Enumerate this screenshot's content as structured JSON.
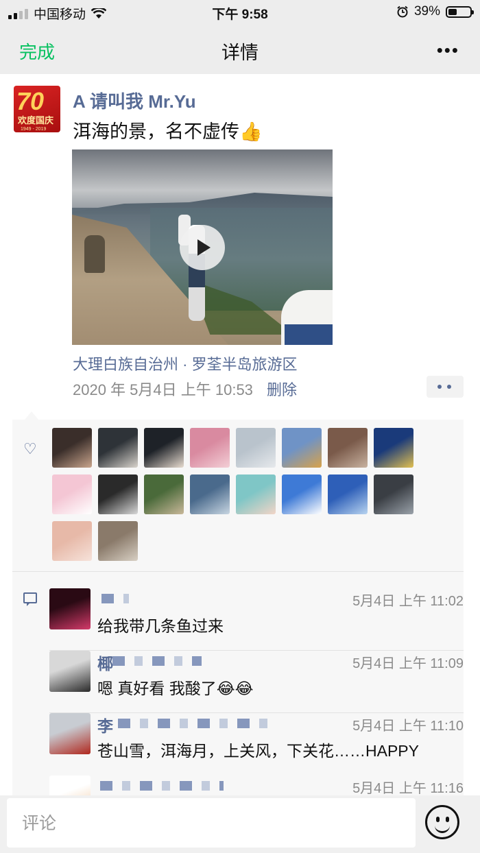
{
  "status_bar": {
    "carrier": "中国移动",
    "time": "下午 9:58",
    "battery": "39%",
    "battery_level": 0.39
  },
  "nav": {
    "done_label": "完成",
    "title": "详情",
    "more": "•••"
  },
  "post": {
    "author": "A 请叫我 Mr.Yu",
    "avatar_badge_number": "70",
    "avatar_badge_text": "欢度国庆",
    "avatar_badge_years": "1949 - 2019",
    "text": "洱海的景，名不虚传👍",
    "location": "大理白族自治州 · 罗荃半岛旅游区",
    "timestamp": "2020 年 5月4日 上午 10:53",
    "delete_label": "删除"
  },
  "likes": {
    "icon": "heart-icon",
    "avatar_colors": [
      [
        "#3a2e2a",
        "#c9a58d"
      ],
      [
        "#2e3338",
        "#d9d4cd"
      ],
      [
        "#1e2228",
        "#e8dcd0"
      ],
      [
        "#d98aa0",
        "#f3cfd6"
      ],
      [
        "#b9c3cc",
        "#e6e9ec"
      ],
      [
        "#6f93c6",
        "#d8a24a"
      ],
      [
        "#7a5a4a",
        "#c8b2a0"
      ],
      [
        "#1a3a7a",
        "#e2c050"
      ],
      [
        "#f4c6d4",
        "#ffffff"
      ],
      [
        "#2a2a2a",
        "#d8d8d8"
      ],
      [
        "#4a6a3a",
        "#c9b89a"
      ],
      [
        "#4a6a8c",
        "#c8d6e2"
      ],
      [
        "#7fc6c6",
        "#f3d5c7"
      ],
      [
        "#3e7ad6",
        "#ffffff"
      ],
      [
        "#2e5fb8",
        "#b8d4f0"
      ],
      [
        "#3a3e44",
        "#9aa2aa"
      ],
      [
        "#e7b9a8",
        "#f6e2da"
      ],
      [
        "#8a7a6a",
        "#d8d0c4"
      ]
    ]
  },
  "comments": [
    {
      "name": "",
      "time": "5月4日 上午 11:02",
      "text": "给我带几条鱼过来",
      "avatar_colors": [
        "#2a0a14",
        "#d43a6a"
      ]
    },
    {
      "name": "椰",
      "time": "5月4日 上午 11:09",
      "text": "嗯  真好看   我酸了😂😂",
      "avatar_colors": [
        "#d8d8d8",
        "#2a2a2a"
      ]
    },
    {
      "name": "李",
      "time": "5月4日 上午 11:10",
      "text": "苍山雪，洱海月，上关风，下关花……HAPPY",
      "avatar_colors": [
        "#c8ccd2",
        "#b0281e"
      ]
    },
    {
      "name": "",
      "time": "5月4日 上午 11:16",
      "text": "",
      "avatar_colors": [
        "#ffffff",
        "#f0c8a0"
      ]
    }
  ],
  "input": {
    "placeholder": "评论",
    "emoji_icon": "smile-icon"
  }
}
